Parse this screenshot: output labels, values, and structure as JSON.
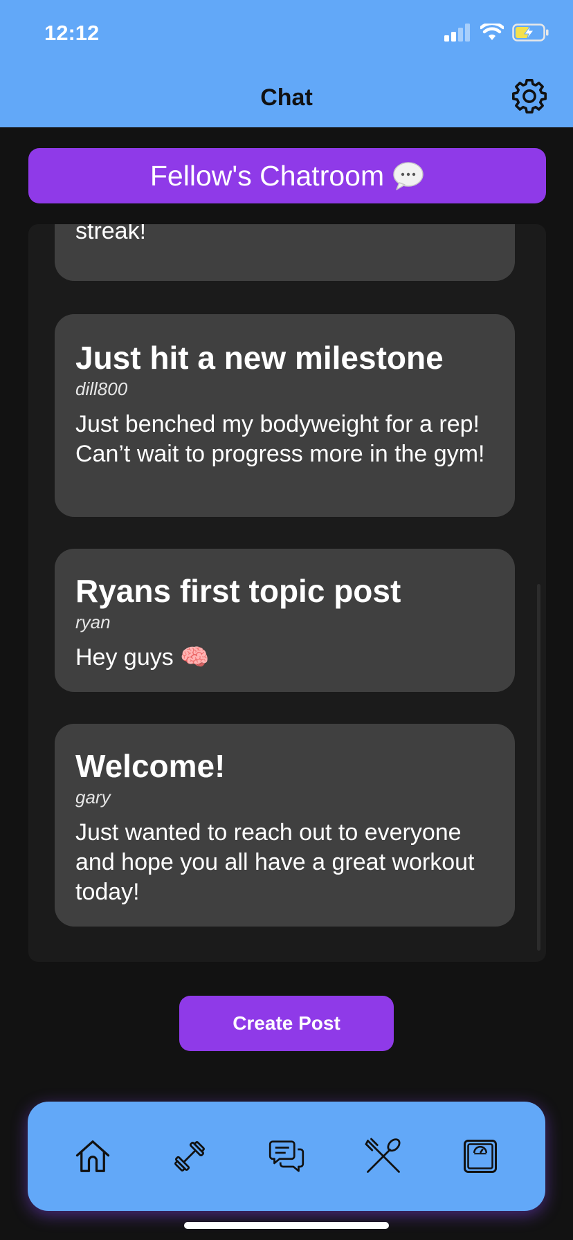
{
  "status_bar": {
    "time": "12:12",
    "icons": [
      "signal-icon",
      "wifi-icon",
      "battery-charging-icon"
    ]
  },
  "header": {
    "title": "Chat",
    "settings_icon": "gear-icon"
  },
  "chatroom": {
    "title": "Fellow's Chatroom",
    "icon": "speech-bubble-icon"
  },
  "posts": [
    {
      "title": "",
      "author": "",
      "body": "time you work out to maintain your streak!"
    },
    {
      "title": "Just hit a new milestone",
      "author": "dill800",
      "body": "Just benched my bodyweight for a rep! Can’t wait to progress more in the gym!"
    },
    {
      "title": "Ryans first topic post",
      "author": "ryan",
      "body": "Hey guys 🧠"
    },
    {
      "title": "Welcome!",
      "author": "gary",
      "body": "Just wanted to reach out to everyone and hope you all have a great workout today!"
    }
  ],
  "actions": {
    "create_post_label": "Create Post"
  },
  "tab_bar": {
    "items": [
      {
        "icon": "home-icon"
      },
      {
        "icon": "dumbbell-icon"
      },
      {
        "icon": "chat-icon"
      },
      {
        "icon": "fork-spoon-icon"
      },
      {
        "icon": "scale-icon"
      }
    ]
  },
  "colors": {
    "header_blue": "#62a8f8",
    "accent_purple": "#8f3ae8",
    "background": "#121212",
    "card": "#404040"
  }
}
